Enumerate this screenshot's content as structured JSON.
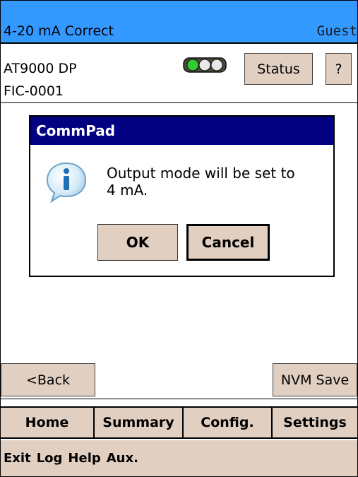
{
  "header": {
    "title": "4-20 mA Correct",
    "user": "Guest"
  },
  "device": {
    "model": "AT9000 DP",
    "tag": "FIC-0001",
    "indicator": "traffic-light-icon",
    "status_button": "Status",
    "help_button": "?"
  },
  "dialog": {
    "title": "CommPad",
    "icon": "info-icon",
    "message_line1": "Output mode will be set to",
    "message_line2": "4 mA.",
    "ok_label": "OK",
    "cancel_label": "Cancel"
  },
  "actions": {
    "back_label": "<Back",
    "nvm_save_label": "NVM Save"
  },
  "nav": {
    "tabs": [
      {
        "label": "Home"
      },
      {
        "label": "Summary"
      },
      {
        "label": "Config."
      },
      {
        "label": "Settings"
      }
    ]
  },
  "menu": {
    "items": [
      {
        "label": "Exit"
      },
      {
        "label": "Log"
      },
      {
        "label": "Help"
      },
      {
        "label": "Aux."
      }
    ]
  },
  "colors": {
    "titlebar": "#3399ff",
    "dialog_title": "#000080",
    "button_face": "#e1cfc2",
    "indicator_active": "#33cc33"
  }
}
